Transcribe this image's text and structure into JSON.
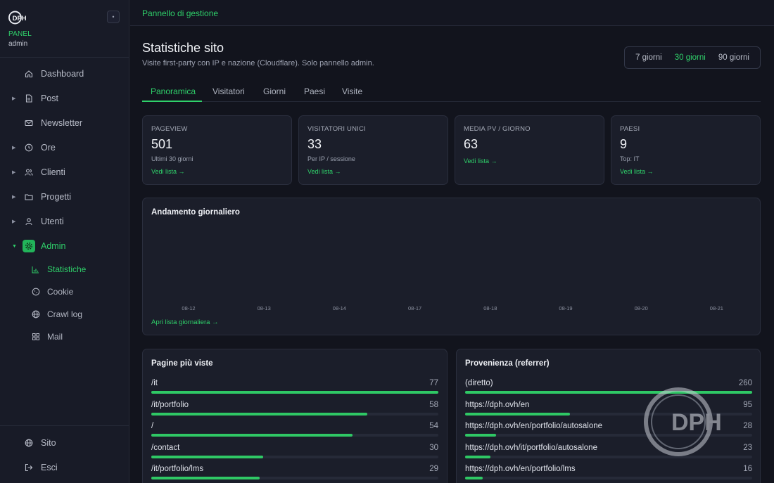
{
  "sidebar": {
    "brand_panel": "PANEL",
    "brand_user": "admin",
    "items": [
      {
        "label": "Dashboard",
        "icon": "home-icon",
        "caret": false
      },
      {
        "label": "Post",
        "icon": "document-icon",
        "caret": true
      },
      {
        "label": "Newsletter",
        "icon": "mail-icon",
        "caret": false
      },
      {
        "label": "Ore",
        "icon": "clock-icon",
        "caret": true
      },
      {
        "label": "Clienti",
        "icon": "users-icon",
        "caret": true
      },
      {
        "label": "Progetti",
        "icon": "folder-icon",
        "caret": true
      },
      {
        "label": "Utenti",
        "icon": "user-icon",
        "caret": true
      },
      {
        "label": "Admin",
        "icon": "gear-icon",
        "caret": true,
        "expanded": true,
        "active": true
      }
    ],
    "subitems": [
      {
        "label": "Statistiche",
        "icon": "bar-chart-icon",
        "active": true
      },
      {
        "label": "Cookie",
        "icon": "cookie-icon"
      },
      {
        "label": "Crawl log",
        "icon": "globe-icon"
      },
      {
        "label": "Mail",
        "icon": "grid-icon"
      }
    ],
    "footer": [
      {
        "label": "Sito",
        "icon": "globe-icon"
      },
      {
        "label": "Esci",
        "icon": "logout-icon"
      }
    ]
  },
  "topbar": {
    "title": "Pannello di gestione"
  },
  "page": {
    "title": "Statistiche sito",
    "subtitle": "Visite first-party con IP e nazione (Cloudflare). Solo pannello admin."
  },
  "range": {
    "options": [
      "7 giorni",
      "30 giorni",
      "90 giorni"
    ],
    "selected": "30 giorni"
  },
  "tabs": [
    {
      "label": "Panoramica",
      "active": true
    },
    {
      "label": "Visitatori"
    },
    {
      "label": "Giorni"
    },
    {
      "label": "Paesi"
    },
    {
      "label": "Visite"
    }
  ],
  "kpis": [
    {
      "label": "PAGEVIEW",
      "value": "501",
      "note": "Ultimi 30 giorni",
      "link": "Vedi lista →"
    },
    {
      "label": "VISITATORI UNICI",
      "value": "33",
      "note": "Per IP / sessione",
      "link": "Vedi lista →"
    },
    {
      "label": "MEDIA PV / GIORNO",
      "value": "63",
      "note": "",
      "link": "Vedi lista →"
    },
    {
      "label": "PAESI",
      "value": "9",
      "note": "Top: IT",
      "link": "Vedi lista →"
    }
  ],
  "chart": {
    "title": "Andamento giornaliero",
    "link": "Apri lista giornaliera →"
  },
  "chart_data": {
    "type": "bar",
    "title": "Andamento giornaliero",
    "categories": [
      "08-12",
      "08-13",
      "08-14",
      "08-17",
      "08-18",
      "08-19",
      "08-20",
      "08-21"
    ],
    "values": [],
    "xlabel": "",
    "ylabel": ""
  },
  "top_pages": {
    "title": "Pagine più viste",
    "rows": [
      {
        "label": "/it",
        "value": 77
      },
      {
        "label": "/it/portfolio",
        "value": 58
      },
      {
        "label": "/",
        "value": 54
      },
      {
        "label": "/contact",
        "value": 30
      },
      {
        "label": "/it/portfolio/lms",
        "value": 29
      }
    ]
  },
  "referrers": {
    "title": "Provenienza (referrer)",
    "rows": [
      {
        "label": "(diretto)",
        "value": 260
      },
      {
        "label": "https://dph.ovh/en",
        "value": 95
      },
      {
        "label": "https://dph.ovh/en/portfolio/autosalone",
        "value": 28
      },
      {
        "label": "https://dph.ovh/it/portfolio/autosalone",
        "value": 23
      },
      {
        "label": "https://dph.ovh/en/portfolio/lms",
        "value": 16
      }
    ]
  },
  "colors": {
    "accent": "#2fd06a",
    "background": "#12141d",
    "card": "#1b1e2a"
  }
}
